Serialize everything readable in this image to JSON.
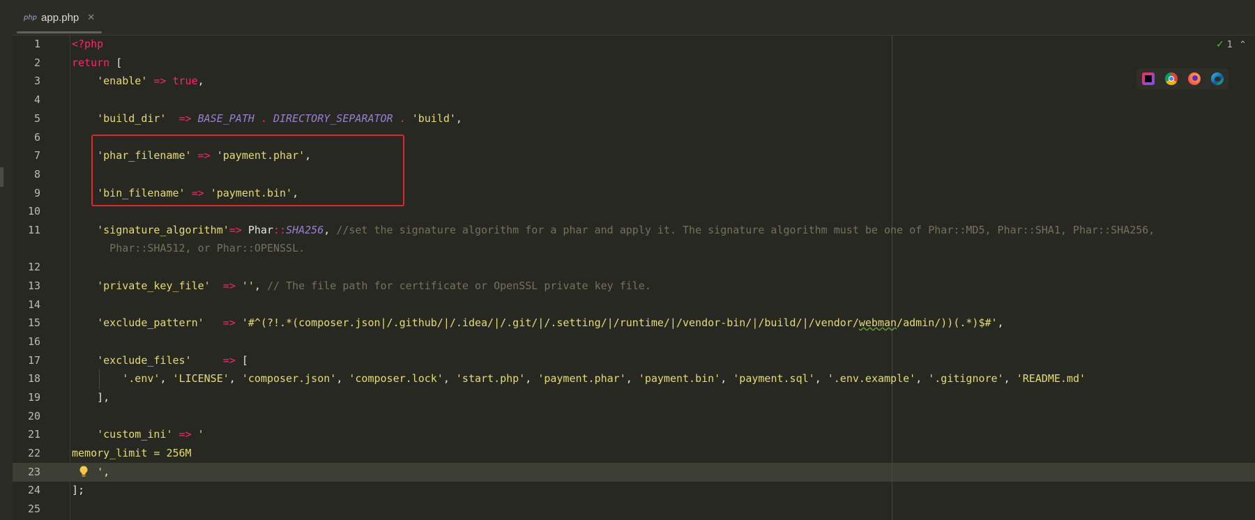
{
  "tab": {
    "icon_label": "php",
    "filename": "app.php",
    "close_glyph": "✕"
  },
  "inspections": {
    "check_glyph": "✓",
    "count": "1",
    "up_glyph": "⌃"
  },
  "browsers": [
    "phpstorm-icon",
    "chrome-icon",
    "firefox-icon",
    "edge-icon"
  ],
  "line_numbers": [
    "1",
    "2",
    "3",
    "4",
    "5",
    "6",
    "7",
    "8",
    "9",
    "10",
    "11",
    "12",
    "13",
    "14",
    "15",
    "16",
    "17",
    "18",
    "19",
    "20",
    "21",
    "22",
    "23",
    "24",
    "25"
  ],
  "code": {
    "l1": [
      "<?php"
    ],
    "l2": [
      "return",
      " ["
    ],
    "l3": [
      "    ",
      "'enable'",
      " => ",
      "true",
      ","
    ],
    "l5": [
      "    ",
      "'build_dir'",
      "  => ",
      "BASE_PATH",
      " . ",
      "DIRECTORY_SEPARATOR",
      " . ",
      "'build'",
      ","
    ],
    "l7": [
      "    ",
      "'phar_filename'",
      " => ",
      "'payment.phar'",
      ","
    ],
    "l9": [
      "    ",
      "'bin_filename'",
      " => ",
      "'payment.bin'",
      ","
    ],
    "l11": [
      "    ",
      "'signature_algorithm'",
      "=> ",
      "Phar",
      "::",
      "SHA256",
      ", ",
      "//set the signature algorithm for a phar and apply it. The signature algorithm must be one of Phar::MD5, Phar::SHA1, Phar::SHA256,"
    ],
    "l11b": [
      "      Phar::SHA512, or Phar::OPENSSL."
    ],
    "l13": [
      "    ",
      "'private_key_file'",
      "  => ",
      "''",
      ", ",
      "// The file path for certificate or OpenSSL private key file."
    ],
    "l15": [
      "    ",
      "'exclude_pattern'",
      "   => ",
      "'#^(?!.*(composer.json|/.github/|/.idea/|/.git/|/.setting/|/runtime/|/vendor-bin/|/build/|/vendor/",
      "webman",
      "/admin/))(.*)$#'",
      ","
    ],
    "l17": [
      "    ",
      "'exclude_files'",
      "     => ",
      "["
    ],
    "l18": [
      "        ",
      "'.env'",
      ", ",
      "'LICENSE'",
      ", ",
      "'composer.json'",
      ", ",
      "'composer.lock'",
      ", ",
      "'start.php'",
      ", ",
      "'payment.phar'",
      ", ",
      "'payment.bin'",
      ", ",
      "'payment.sql'",
      ", ",
      "'.env.example'",
      ", ",
      "'.gitignore'",
      ", ",
      "'README.md'"
    ],
    "l19": [
      "    ],"
    ],
    "l21": [
      "    ",
      "'custom_ini'",
      " => ",
      "'"
    ],
    "l22": [
      "memory_limit = 256M"
    ],
    "l23": [
      "    ",
      "'",
      ","
    ],
    "l24": [
      "];"
    ]
  }
}
